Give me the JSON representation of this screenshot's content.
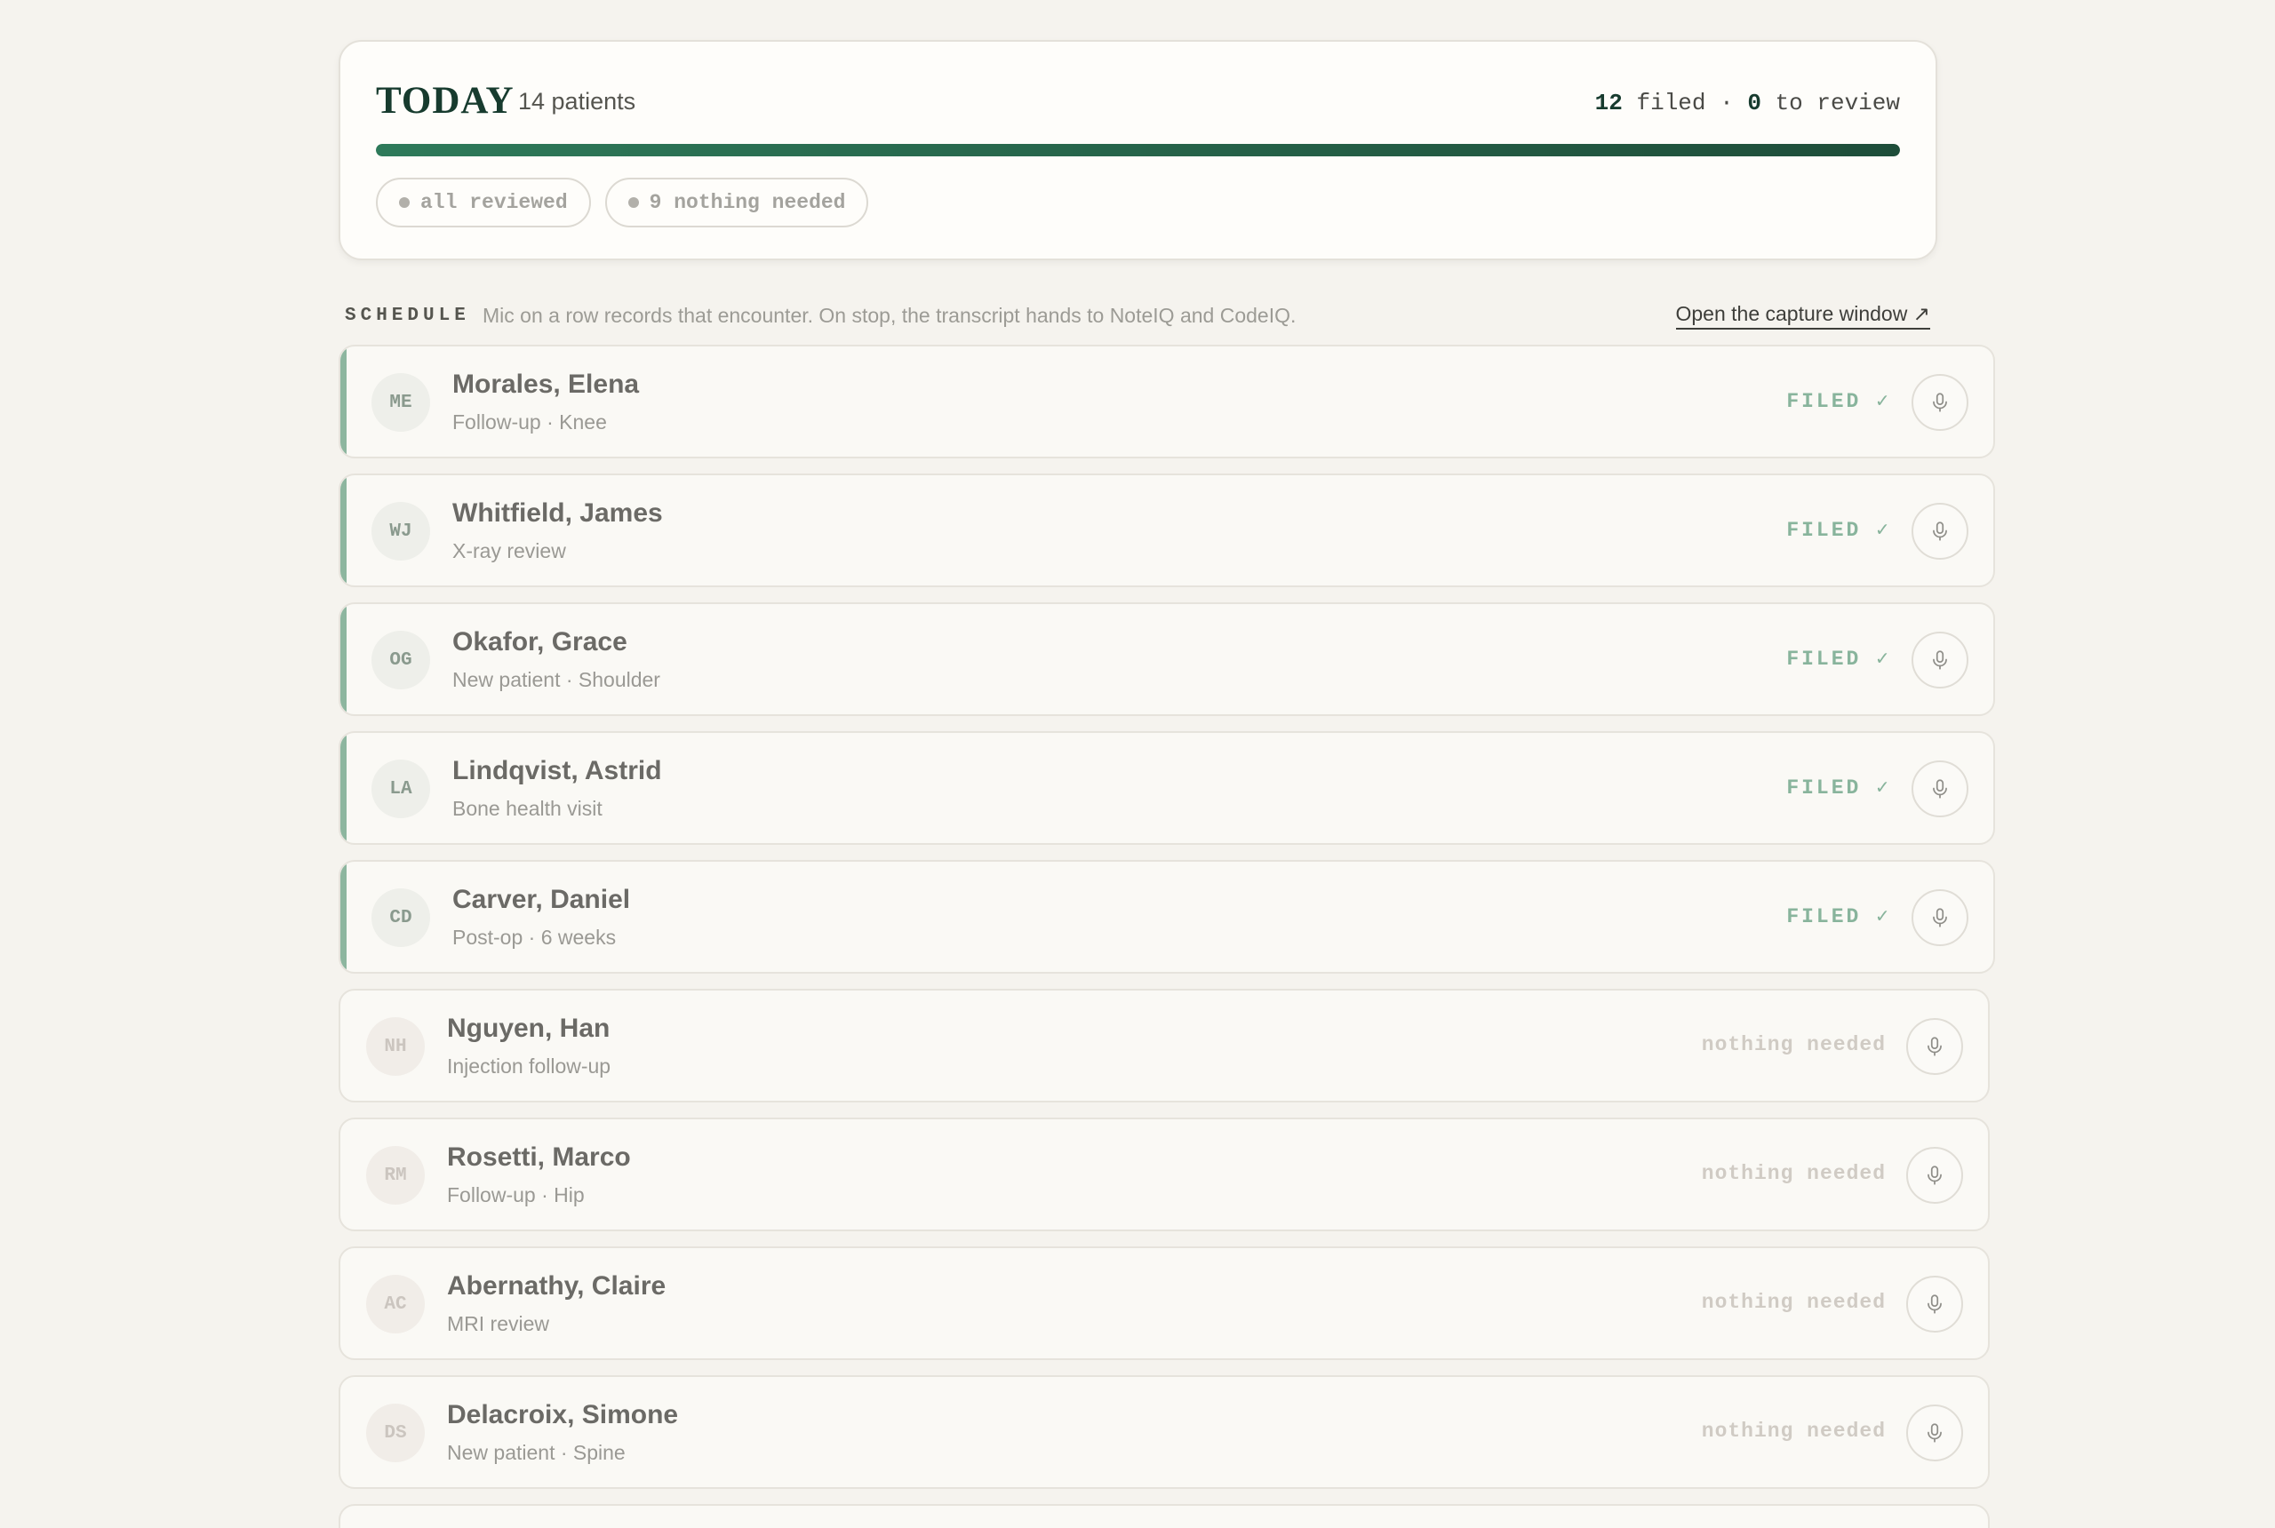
{
  "today": {
    "title": "TODAY",
    "patient_count": "14 patients",
    "filed_count": "12",
    "filed_label": "filed",
    "separator": "·",
    "review_count": "0",
    "review_label": "to review",
    "progress_fraction": 1.0,
    "pills": [
      {
        "label": "all reviewed"
      },
      {
        "label": "9 nothing needed"
      }
    ]
  },
  "schedule": {
    "label": "SCHEDULE",
    "description": "Mic on a row records that encounter. On stop, the transcript hands to NoteIQ and CodeIQ.",
    "capture_link": "Open the capture window ↗"
  },
  "rows": [
    {
      "initials": "ME",
      "name": "Morales, Elena",
      "sub": "Follow-up · Knee",
      "status": "FILED ✓",
      "state": "filed"
    },
    {
      "initials": "WJ",
      "name": "Whitfield, James",
      "sub": "X-ray review",
      "status": "FILED ✓",
      "state": "filed"
    },
    {
      "initials": "OG",
      "name": "Okafor, Grace",
      "sub": "New patient · Shoulder",
      "status": "FILED ✓",
      "state": "filed"
    },
    {
      "initials": "LA",
      "name": "Lindqvist, Astrid",
      "sub": "Bone health visit",
      "status": "FILED ✓",
      "state": "filed"
    },
    {
      "initials": "CD",
      "name": "Carver, Daniel",
      "sub": "Post-op · 6 weeks",
      "status": "FILED ✓",
      "state": "filed"
    },
    {
      "initials": "NH",
      "name": "Nguyen, Han",
      "sub": "Injection follow-up",
      "status": "nothing needed",
      "state": "nothing"
    },
    {
      "initials": "RM",
      "name": "Rosetti, Marco",
      "sub": "Follow-up · Hip",
      "status": "nothing needed",
      "state": "nothing"
    },
    {
      "initials": "AC",
      "name": "Abernathy, Claire",
      "sub": "MRI review",
      "status": "nothing needed",
      "state": "nothing"
    },
    {
      "initials": "DS",
      "name": "Delacroix, Simone",
      "sub": "New patient · Spine",
      "status": "nothing needed",
      "state": "nothing"
    }
  ],
  "colors": {
    "accent_dark": "#173b2e",
    "progress_start": "#2e7a5a",
    "progress_end": "#1e4d39",
    "filed_status": "#88b49c",
    "filed_stripe": "#8db69f",
    "background": "#f5f3ee"
  },
  "icons": {
    "mic": "microphone-icon"
  }
}
